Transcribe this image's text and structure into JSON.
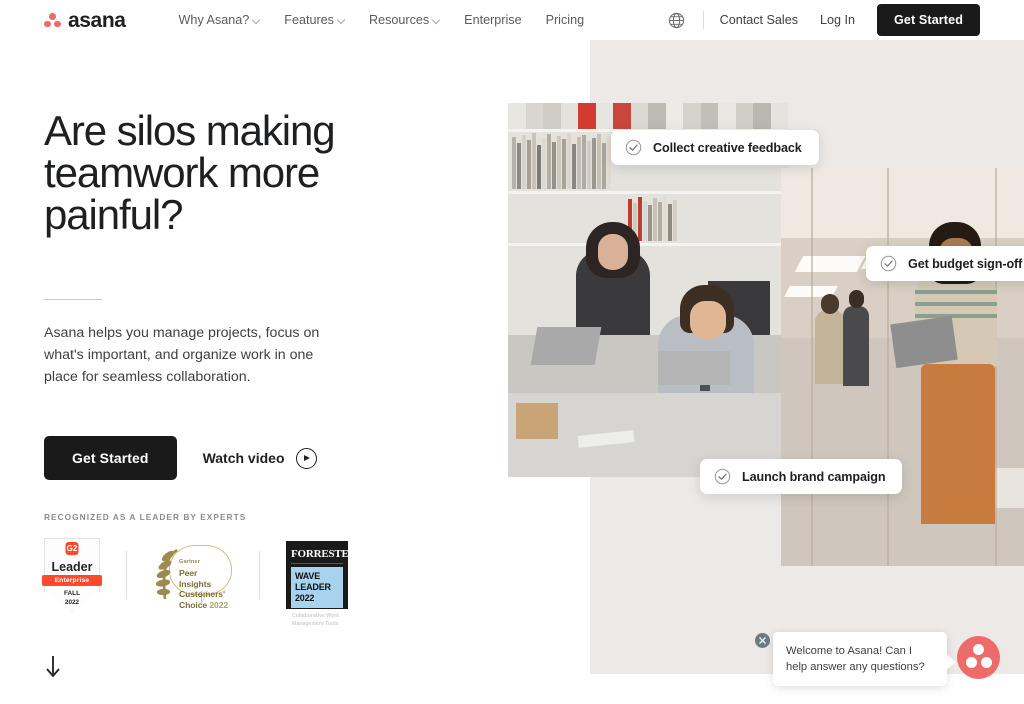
{
  "brand": {
    "name": "asana",
    "logo_icon": "asana-dots-logo",
    "accent_color": "#f06a6a",
    "dark_color": "#1a1a1a",
    "panel_color": "#ece9e6"
  },
  "header": {
    "nav_items": [
      {
        "label": "Why Asana?",
        "has_chevron": true
      },
      {
        "label": "Features",
        "has_chevron": true
      },
      {
        "label": "Resources",
        "has_chevron": true
      },
      {
        "label": "Enterprise",
        "has_chevron": false
      },
      {
        "label": "Pricing",
        "has_chevron": false
      }
    ],
    "globe_icon": "globe-icon",
    "contact_sales": "Contact Sales",
    "log_in": "Log In",
    "get_started": "Get Started"
  },
  "hero": {
    "headline": "Are silos making teamwork more painful?",
    "subcopy": "Asana helps you manage projects, focus on what's important, and organize work in one place for seamless collaboration.",
    "primary_cta": "Get Started",
    "secondary_cta": "Watch video",
    "play_icon": "play-icon",
    "scroll_icon": "arrow-down-icon"
  },
  "awards": {
    "label": "RECOGNIZED AS A LEADER BY EXPERTS",
    "items": [
      {
        "id": "g2-leader-badge",
        "logo": "G2",
        "title": "Leader",
        "band": "Enterprise",
        "season": "FALL",
        "year": "2022"
      },
      {
        "id": "gartner-peer-insights-badge",
        "brand": "Gartner",
        "line1": "Peer Insights",
        "line2": "Customers'",
        "line3": "Choice",
        "year": "2022"
      },
      {
        "id": "forrester-wave-badge",
        "brand": "FORRESTER",
        "line1": "WAVE",
        "line2": "LEADER 2022",
        "subtitle": "Collaborative Work Management Tools"
      }
    ]
  },
  "chips": [
    {
      "id": "chip-collect-creative-feedback",
      "label": "Collect creative feedback",
      "icon": "check-circle-icon"
    },
    {
      "id": "chip-get-budget-sign-off",
      "label": "Get budget sign-off",
      "icon": "check-circle-icon"
    },
    {
      "id": "chip-launch-brand-campaign",
      "label": "Launch brand campaign",
      "icon": "check-circle-icon"
    }
  ],
  "photos": [
    {
      "id": "photo-office-bookshelf",
      "alt": "Two colleagues working at a desk in front of a bookshelf"
    },
    {
      "id": "photo-office-corridor",
      "alt": "Woman holding a laptop in a bright open office"
    }
  ],
  "chat": {
    "message": "Welcome to Asana! Can I help answer any questions?",
    "close_icon": "close-icon",
    "launcher_icon": "asana-dots-logo",
    "launcher_color": "#ef6b6b"
  }
}
